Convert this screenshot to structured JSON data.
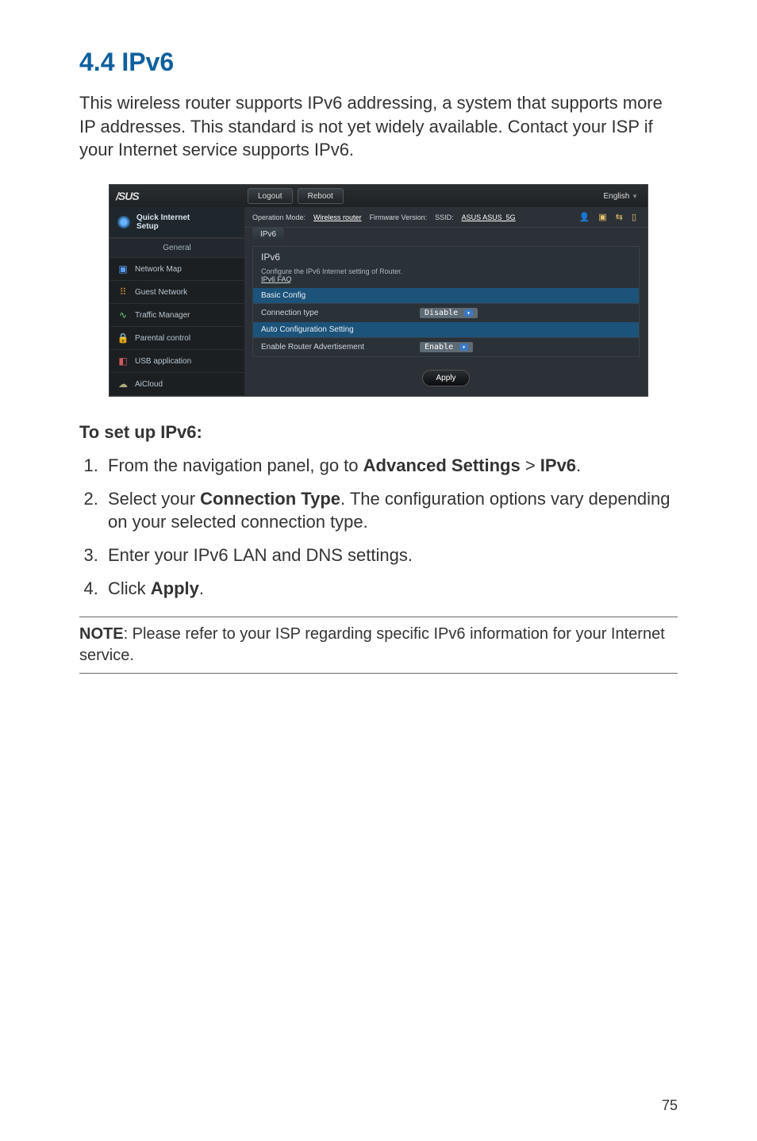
{
  "heading": "4.4    IPv6",
  "intro": "This wireless router supports IPv6 addressing, a system that supports more IP addresses. This standard is not yet widely available. Contact your ISP if your Internet service supports IPv6.",
  "shot": {
    "logo": "/SUS",
    "btn_logout": "Logout",
    "btn_reboot": "Reboot",
    "language": "English",
    "infoline": {
      "op_mode_label": "Operation Mode:",
      "op_mode_value": "Wireless router",
      "fw_label": "Firmware Version:",
      "ssid_label": "SSID:",
      "ssid_values": "ASUS  ASUS_5G"
    },
    "tab": "IPv6",
    "side": {
      "qis_line1": "Quick Internet",
      "qis_line2": "Setup",
      "general": "General",
      "items": [
        "Network Map",
        "Guest Network",
        "Traffic Manager",
        "Parental control",
        "USB application",
        "AiCloud"
      ]
    },
    "panel": {
      "title": "IPv6",
      "sub_text": "Configure the IPv6 Internet setting of Router.",
      "faq": "IPv6 FAQ",
      "basic_config": "Basic Config",
      "conn_type_label": "Connection type",
      "conn_type_value": "Disable",
      "auto_conf": "Auto Configuration Setting",
      "enable_ra_label": "Enable Router Advertisement",
      "enable_ra_value": "Enable",
      "apply": "Apply"
    }
  },
  "subhead": "To set up IPv6:",
  "steps": {
    "s1_a": "From the navigation panel, go to ",
    "s1_b": "Advanced Settings",
    "s1_c": " > ",
    "s1_d": "IPv6",
    "s1_e": ".",
    "s2_a": "Select your ",
    "s2_b": "Connection Type",
    "s2_c": ". The configuration options vary depending on your selected connection type.",
    "s3": "Enter your IPv6 LAN and DNS settings.",
    "s4_a": "Click ",
    "s4_b": "Apply",
    "s4_c": "."
  },
  "note_label": "NOTE",
  "note_text": ": Please refer to your ISP regarding specific IPv6 information for your Internet service.",
  "page_number": "75"
}
